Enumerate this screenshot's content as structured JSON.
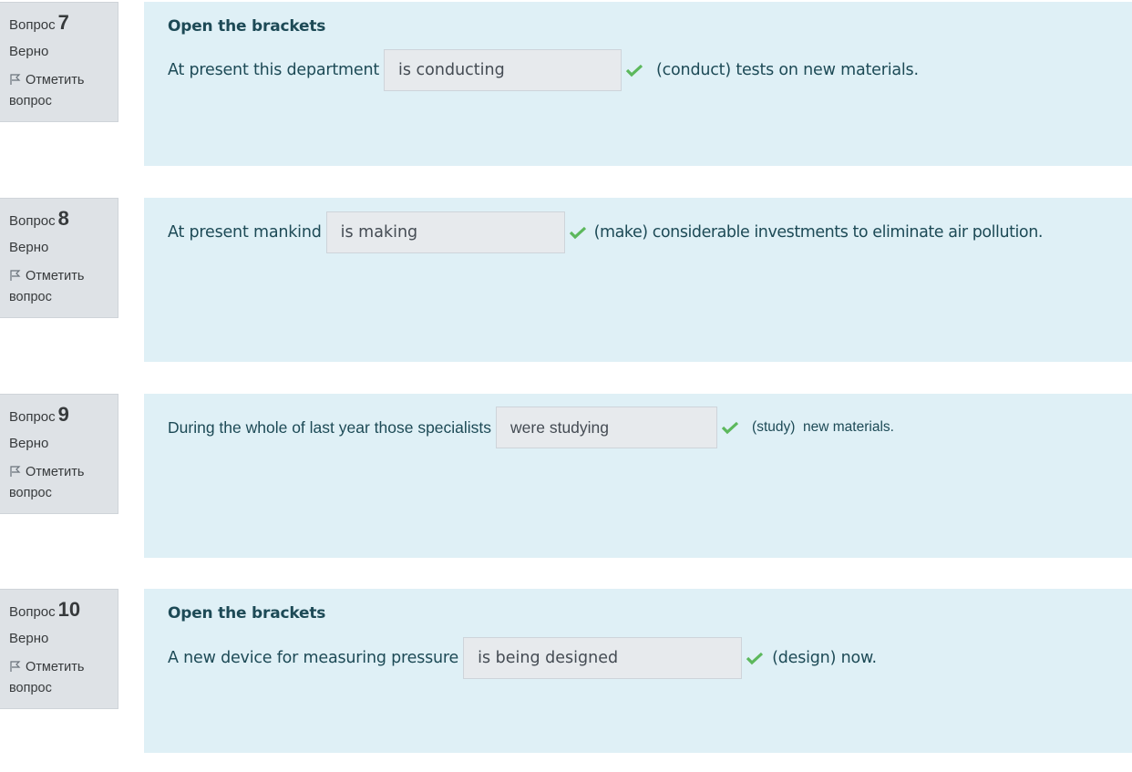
{
  "questions": [
    {
      "word": "Вопрос",
      "number": "7",
      "state": "Верно",
      "flag": "Отметить вопрос",
      "title": "Open the brackets",
      "before": "At present this department",
      "answer": "is conducting",
      "after": "(conduct) tests on new materials."
    },
    {
      "word": "Вопрос",
      "number": "8",
      "state": "Верно",
      "flag": "Отметить вопрос",
      "title": "",
      "before": "At present mankind",
      "answer": "is making",
      "after": "(make) considerable investments to eliminate air pollution."
    },
    {
      "word": "Вопрос",
      "number": "9",
      "state": "Верно",
      "flag": "Отметить вопрос",
      "title": "",
      "before": "During the whole of last year those specialists",
      "answer": "were studying",
      "after": "(study)  new materials."
    },
    {
      "word": "Вопрос",
      "number": "10",
      "state": "Верно",
      "flag": "Отметить вопрос",
      "title": "Open the brackets",
      "before": "A new device for measuring pressure",
      "answer": "is being designed",
      "after": "(design) now."
    }
  ],
  "colors": {
    "info_bg": "#dee2e6",
    "content_bg": "#dff0f6",
    "answer_bg": "#e7eaed",
    "text": "#1d4a56",
    "check": "#5cb85c"
  },
  "icons": [
    "flag-icon",
    "check-icon"
  ]
}
